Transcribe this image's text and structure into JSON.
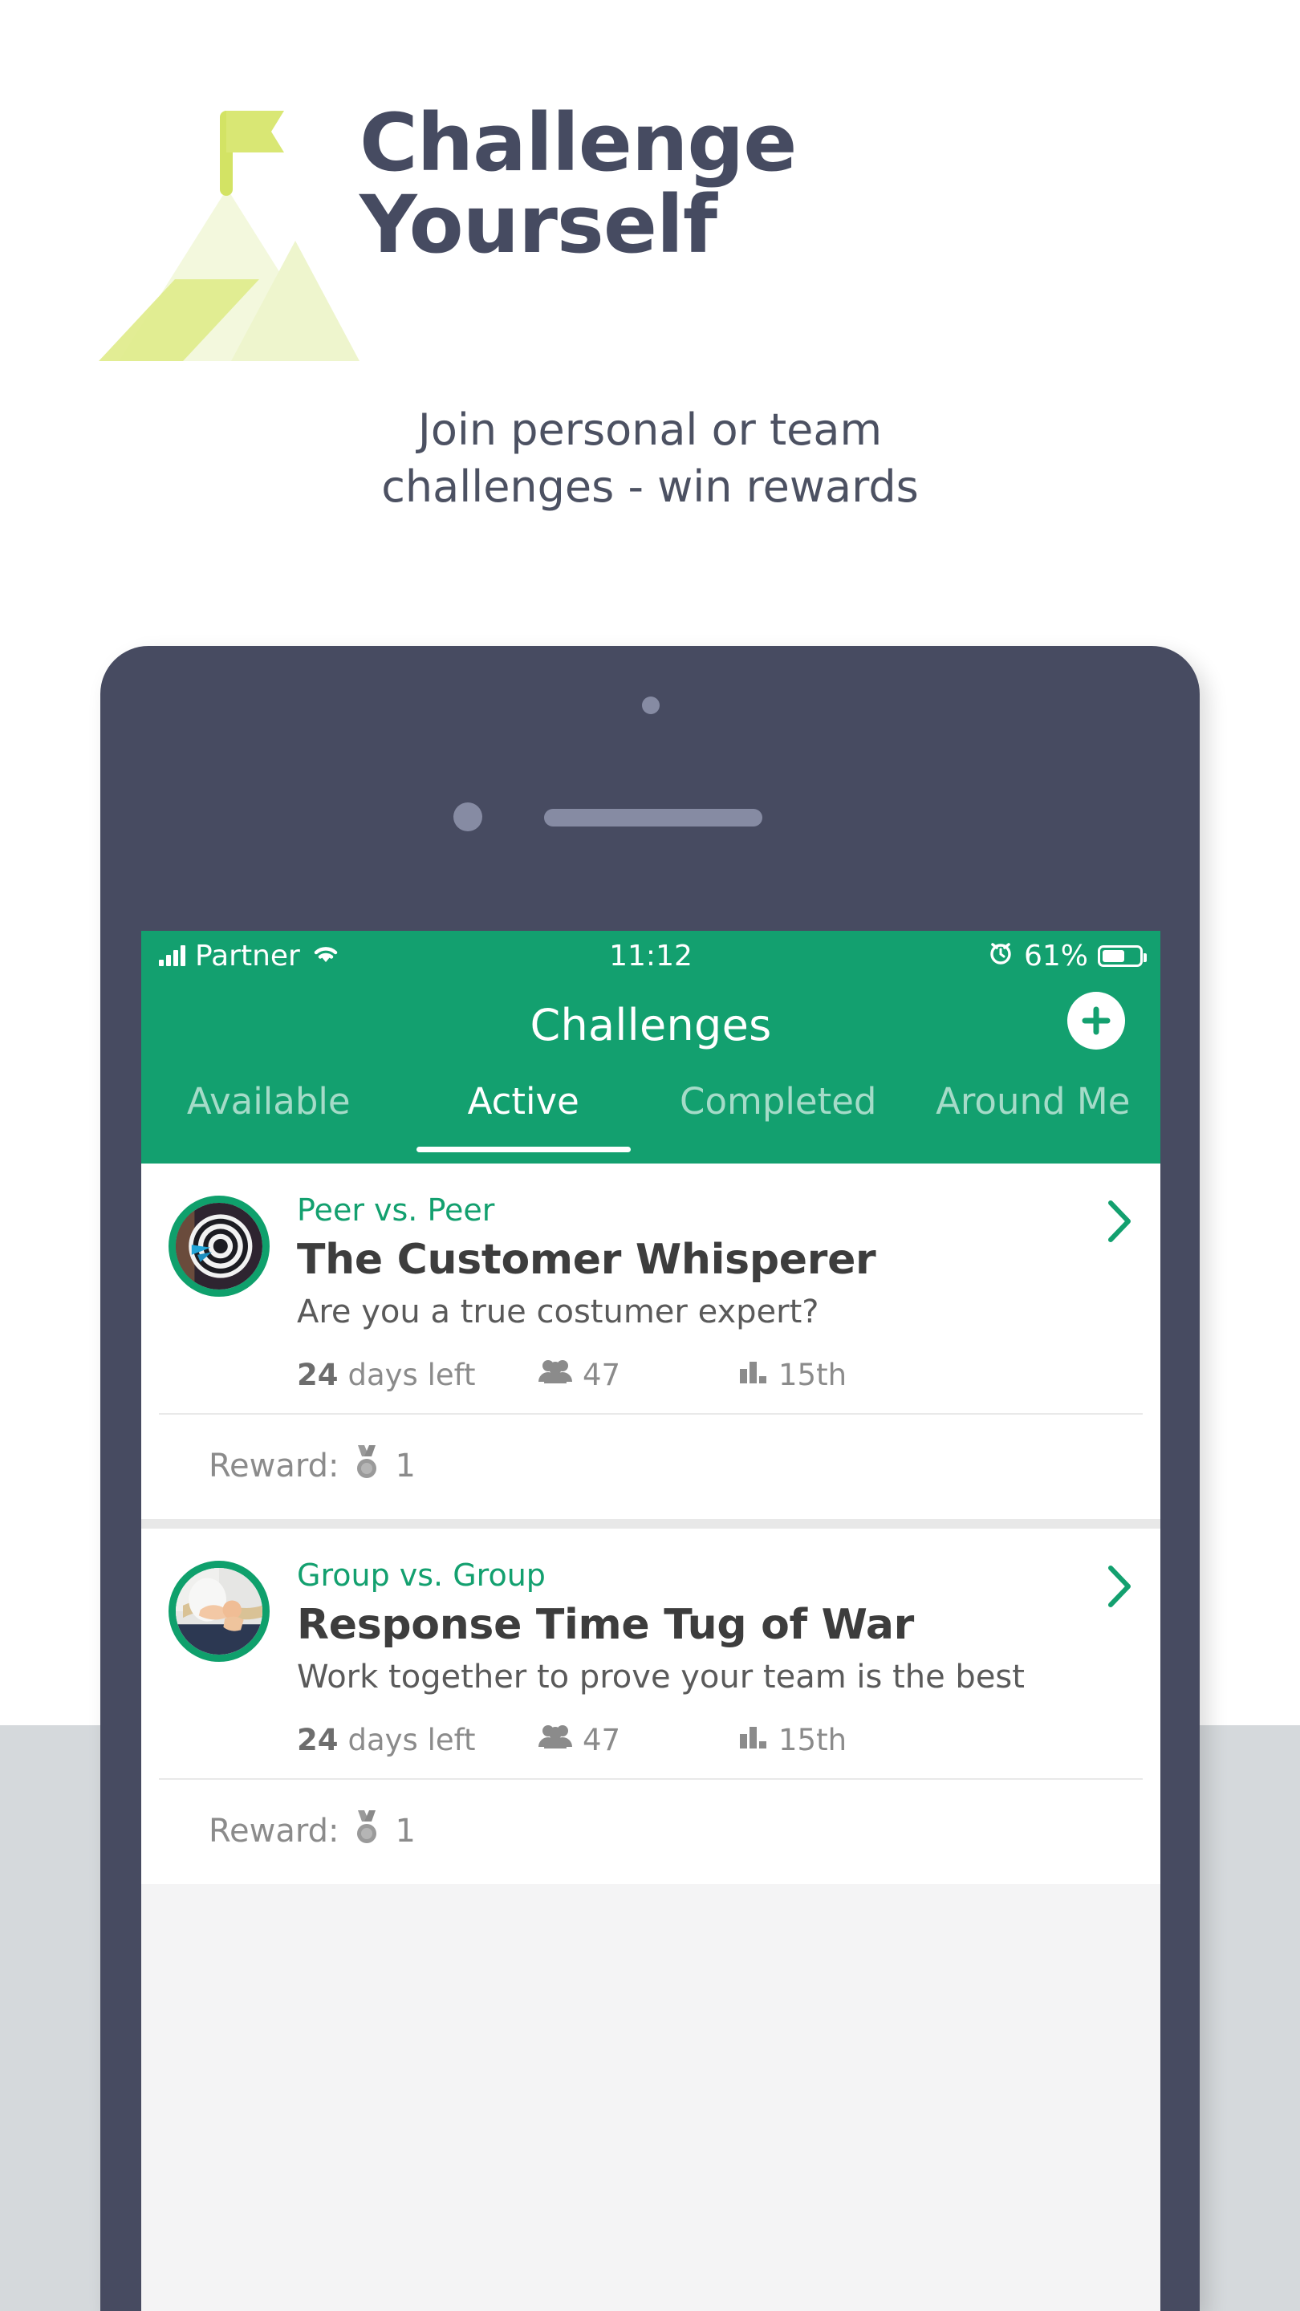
{
  "hero": {
    "headline": "Challenge\nYourself",
    "subtitle": "Join personal or team\nchallenges - win rewards",
    "logo_icon": "mountain-flag-icon",
    "colors": {
      "headline": "#464b61",
      "mountain_light": "#f2f7dc",
      "mountain_mid": "#edf3c9",
      "mountain_accent": "#dbe881",
      "flag": "#d6e66f"
    }
  },
  "phone": {
    "bezel_color": "#474b61",
    "camera_icon": "camera-dot-icon",
    "sensor_icon": "sensor-dot-icon",
    "speaker_icon": "earpiece-speaker-icon"
  },
  "status_bar": {
    "carrier": "Partner",
    "time": "11:12",
    "battery_percent": "61%",
    "battery_level": 61,
    "signal_icon": "signal-bars-icon",
    "wifi_icon": "wifi-icon",
    "alarm_icon": "alarm-clock-icon",
    "battery_icon": "battery-icon"
  },
  "nav": {
    "title": "Challenges",
    "add_icon": "plus-circle-icon",
    "accent": "#13a06f"
  },
  "tabs": [
    {
      "label": "Available",
      "active": false
    },
    {
      "label": "Active",
      "active": true
    },
    {
      "label": "Completed",
      "active": false
    },
    {
      "label": "Around Me",
      "active": false
    }
  ],
  "cards": [
    {
      "kicker": "Peer vs. Peer",
      "title": "The Customer Whisperer",
      "description": "Are you a true costumer expert?",
      "days_number": "24",
      "days_label": "days left",
      "participants": "47",
      "rank": "15th",
      "reward_label": "Reward:",
      "reward_value": "1",
      "avatar_icon": "dartboard-avatar",
      "chevron_icon": "chevron-right-icon",
      "people_icon": "people-icon",
      "rank_icon": "bar-chart-icon",
      "reward_icon": "medal-icon"
    },
    {
      "kicker": "Group vs. Group",
      "title": "Response Time Tug of War",
      "description": "Work together to prove your team is the best",
      "days_number": "24",
      "days_label": "days left",
      "participants": "47",
      "rank": "15th",
      "reward_label": "Reward:",
      "reward_value": "1",
      "avatar_icon": "tug-of-war-avatar",
      "chevron_icon": "chevron-right-icon",
      "people_icon": "people-icon",
      "rank_icon": "bar-chart-icon",
      "reward_icon": "medal-icon"
    }
  ]
}
